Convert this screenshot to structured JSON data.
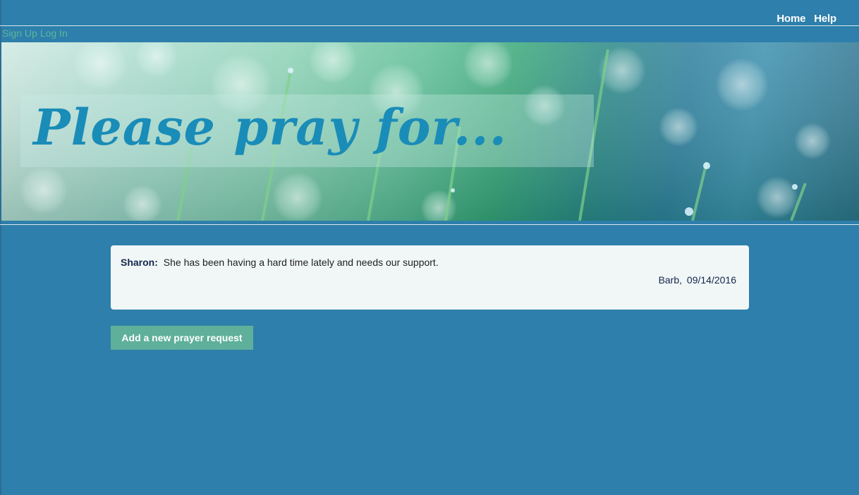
{
  "nav": {
    "home_label": "Home",
    "help_label": "Help"
  },
  "auth": {
    "signup_label": "Sign Up",
    "login_label": "Log In"
  },
  "banner": {
    "title": "Please pray for..."
  },
  "requests": [
    {
      "name": "Sharon:",
      "text": "She has been having a hard time lately and needs our support.",
      "author": "Barb,",
      "date": "09/14/2016"
    }
  ],
  "actions": {
    "add_label": "Add a new prayer request"
  },
  "colors": {
    "page_background": "#2e7fab",
    "card_background": "#f1f7f7",
    "accent_green": "#5fb09a",
    "title_blue": "#1a8cb8"
  }
}
